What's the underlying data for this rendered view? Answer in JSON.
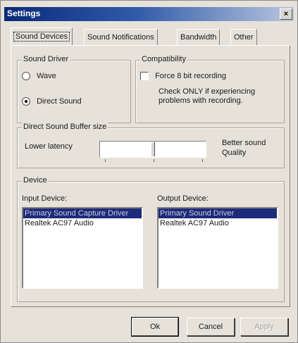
{
  "window": {
    "title": "Settings",
    "close_glyph": "×"
  },
  "tabs": [
    {
      "label": "Sound Devices"
    },
    {
      "label": "Sound Notifications"
    },
    {
      "label": "Bandwidth"
    },
    {
      "label": "Other"
    }
  ],
  "sound_driver": {
    "legend": "Sound Driver",
    "options": [
      {
        "label": "Wave",
        "selected": false
      },
      {
        "label": "Direct Sound",
        "selected": true
      }
    ]
  },
  "compatibility": {
    "legend": "Compatibility",
    "checkbox_label": "Force 8 bit recording",
    "checked": false,
    "note_line1": "Check ONLY if experiencing",
    "note_line2": "problems with recording."
  },
  "buffer": {
    "legend": "Direct Sound Buffer size",
    "left_label": "Lower latency",
    "right_label_line1": "Better sound",
    "right_label_line2": "Quality",
    "level": 0.5
  },
  "device": {
    "legend": "Device",
    "input_label": "Input Device:",
    "input_items": [
      {
        "label": "Primary Sound Capture Driver",
        "selected": true
      },
      {
        "label": "Realtek AC97 Audio",
        "selected": false
      }
    ],
    "output_label": "Output Device:",
    "output_items": [
      {
        "label": "Primary Sound Driver",
        "selected": true
      },
      {
        "label": "Realtek AC97 Audio",
        "selected": false
      }
    ]
  },
  "buttons": {
    "ok": "Ok",
    "cancel": "Cancel",
    "apply": "Apply"
  },
  "colors": {
    "title_start": "#0a2a78",
    "title_end": "#b9c6dd",
    "selection": "#1c2b7a"
  }
}
